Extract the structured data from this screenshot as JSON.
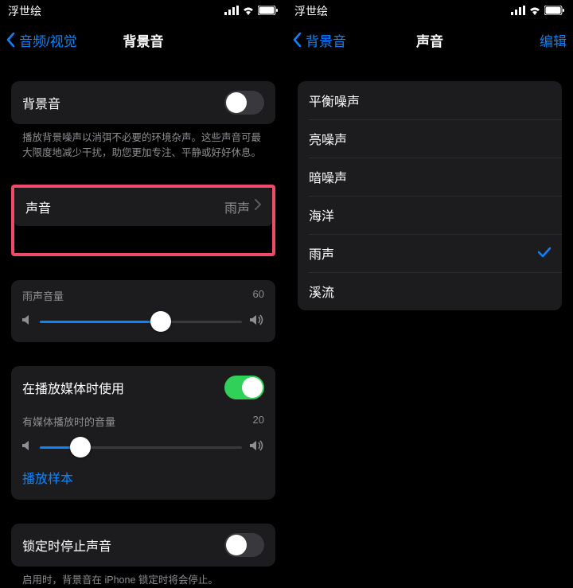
{
  "left": {
    "status": {
      "carrier": "浮世绘"
    },
    "nav": {
      "back": "音频/视觉",
      "title": "背景音"
    },
    "bgToggle": {
      "label": "背景音",
      "on": false
    },
    "bgNote": "播放背景噪声以消弭不必要的环境杂声。这些声音可最大限度地减少干扰，助您更加专注、平静或好好休息。",
    "sound": {
      "label": "声音",
      "value": "雨声"
    },
    "rainVolume": {
      "label": "雨声音量",
      "value": "60",
      "percent": 60
    },
    "mediaToggle": {
      "label": "在播放媒体时使用",
      "on": true
    },
    "mediaVolume": {
      "label": "有媒体播放时的音量",
      "value": "20",
      "percent": 20
    },
    "playSample": "播放样本",
    "lockToggle": {
      "label": "锁定时停止声音",
      "on": false
    },
    "lockNote": "启用时，背景音在 iPhone 锁定时将会停止。"
  },
  "right": {
    "status": {
      "carrier": "浮世绘"
    },
    "nav": {
      "back": "背景音",
      "title": "声音",
      "edit": "编辑"
    },
    "options": [
      {
        "label": "平衡噪声",
        "selected": false
      },
      {
        "label": "亮噪声",
        "selected": false
      },
      {
        "label": "暗噪声",
        "selected": false
      },
      {
        "label": "海洋",
        "selected": false
      },
      {
        "label": "雨声",
        "selected": true
      },
      {
        "label": "溪流",
        "selected": false
      }
    ]
  }
}
